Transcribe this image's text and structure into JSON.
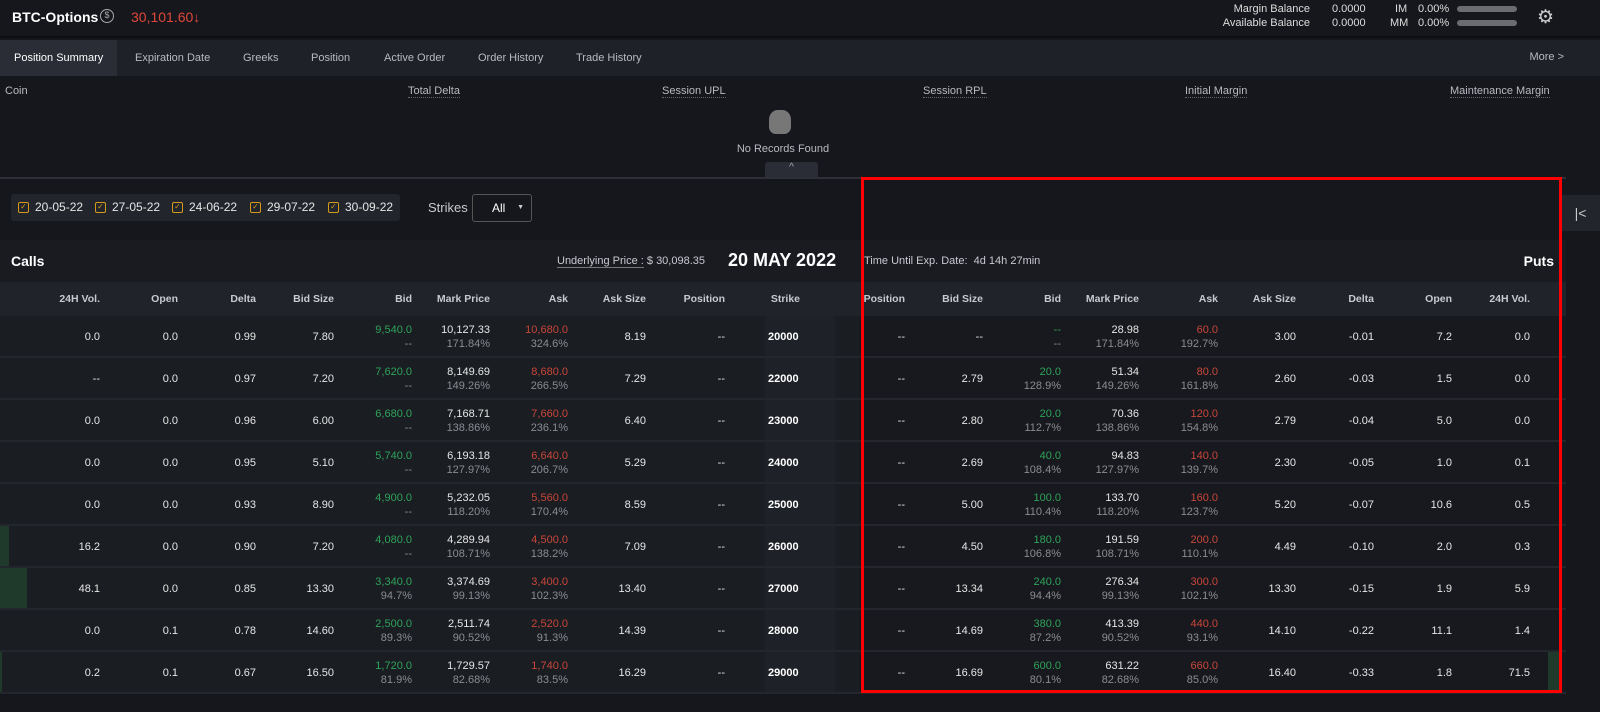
{
  "header": {
    "title": "BTC-Options",
    "coin_icon": "dollar-coin-icon",
    "price": "30,101.60",
    "price_arrow": "↓",
    "margin_balance_label": "Margin Balance",
    "margin_balance": "0.0000",
    "available_balance_label": "Available Balance",
    "available_balance": "0.0000",
    "im_label": "IM",
    "im_value": "0.00%",
    "mm_label": "MM",
    "mm_value": "0.00%",
    "im_fill": 0,
    "mm_fill": 0
  },
  "tabs": [
    "Position Summary",
    "Expiration Date",
    "Greeks",
    "Position",
    "Active Order",
    "Order History",
    "Trade History"
  ],
  "more_label": "More >",
  "summary": {
    "columns": [
      "Coin",
      "Total Delta",
      "Session UPL",
      "Session RPL",
      "Initial Margin",
      "Maintenance Margin"
    ],
    "empty_text": "No Records Found"
  },
  "filters": {
    "dates": [
      "20-05-22",
      "27-05-22",
      "24-06-22",
      "29-07-22",
      "30-09-22"
    ],
    "strikes_label": "Strikes",
    "strikes_value": "All"
  },
  "section": {
    "calls": "Calls",
    "puts": "Puts",
    "underlying_label": "Underlying Price :",
    "underlying_value": "$ 30,098.35",
    "expiry": "20 MAY 2022",
    "time_label": "Time Until Exp. Date:",
    "time_value": "4d 14h 27min"
  },
  "colors": {
    "bid": "#2ea35a",
    "ask": "#c9463a",
    "price_down": "#e0473a",
    "checkbox": "#d49a1a"
  },
  "calls_columns": [
    "24H Vol.",
    "Open",
    "Delta",
    "Bid Size",
    "Bid",
    "Mark Price",
    "Ask",
    "Ask Size",
    "Position",
    "Strike"
  ],
  "puts_columns": [
    "Position",
    "Bid Size",
    "Bid",
    "Mark Price",
    "Ask",
    "Ask Size",
    "Delta",
    "Open",
    "24H Vol."
  ],
  "rows": [
    {
      "strike": "20000",
      "call": {
        "vol": "0.0",
        "open": "0.0",
        "delta": "0.99",
        "bid_size": "7.80",
        "bid": "9,540.0",
        "bid_iv": "--",
        "mark": "10,127.33",
        "mark_iv": "171.84%",
        "ask": "10,680.0",
        "ask_iv": "324.6%",
        "ask_size": "8.19",
        "position": "--"
      },
      "put": {
        "position": "--",
        "bid_size": "--",
        "bid": "--",
        "bid_iv": "--",
        "mark": "28.98",
        "mark_iv": "171.84%",
        "ask": "60.0",
        "ask_iv": "192.7%",
        "ask_size": "3.00",
        "delta": "-0.01",
        "open": "7.2",
        "vol": "0.0"
      }
    },
    {
      "strike": "22000",
      "call": {
        "vol": "--",
        "open": "0.0",
        "delta": "0.97",
        "bid_size": "7.20",
        "bid": "7,620.0",
        "bid_iv": "--",
        "mark": "8,149.69",
        "mark_iv": "149.26%",
        "ask": "8,680.0",
        "ask_iv": "266.5%",
        "ask_size": "7.29",
        "position": "--"
      },
      "put": {
        "position": "--",
        "bid_size": "2.79",
        "bid": "20.0",
        "bid_iv": "128.9%",
        "mark": "51.34",
        "mark_iv": "149.26%",
        "ask": "80.0",
        "ask_iv": "161.8%",
        "ask_size": "2.60",
        "delta": "-0.03",
        "open": "1.5",
        "vol": "0.0"
      }
    },
    {
      "strike": "23000",
      "call": {
        "vol": "0.0",
        "open": "0.0",
        "delta": "0.96",
        "bid_size": "6.00",
        "bid": "6,680.0",
        "bid_iv": "--",
        "mark": "7,168.71",
        "mark_iv": "138.86%",
        "ask": "7,660.0",
        "ask_iv": "236.1%",
        "ask_size": "6.40",
        "position": "--"
      },
      "put": {
        "position": "--",
        "bid_size": "2.80",
        "bid": "20.0",
        "bid_iv": "112.7%",
        "mark": "70.36",
        "mark_iv": "138.86%",
        "ask": "120.0",
        "ask_iv": "154.8%",
        "ask_size": "2.79",
        "delta": "-0.04",
        "open": "5.0",
        "vol": "0.0"
      }
    },
    {
      "strike": "24000",
      "call": {
        "vol": "0.0",
        "open": "0.0",
        "delta": "0.95",
        "bid_size": "5.10",
        "bid": "5,740.0",
        "bid_iv": "--",
        "mark": "6,193.18",
        "mark_iv": "127.97%",
        "ask": "6,640.0",
        "ask_iv": "206.7%",
        "ask_size": "5.29",
        "position": "--"
      },
      "put": {
        "position": "--",
        "bid_size": "2.69",
        "bid": "40.0",
        "bid_iv": "108.4%",
        "mark": "94.83",
        "mark_iv": "127.97%",
        "ask": "140.0",
        "ask_iv": "139.7%",
        "ask_size": "2.30",
        "delta": "-0.05",
        "open": "1.0",
        "vol": "0.1"
      }
    },
    {
      "strike": "25000",
      "call": {
        "vol": "0.0",
        "open": "0.0",
        "delta": "0.93",
        "bid_size": "8.90",
        "bid": "4,900.0",
        "bid_iv": "--",
        "mark": "5,232.05",
        "mark_iv": "118.20%",
        "ask": "5,560.0",
        "ask_iv": "170.4%",
        "ask_size": "8.59",
        "position": "--"
      },
      "put": {
        "position": "--",
        "bid_size": "5.00",
        "bid": "100.0",
        "bid_iv": "110.4%",
        "mark": "133.70",
        "mark_iv": "118.20%",
        "ask": "160.0",
        "ask_iv": "123.7%",
        "ask_size": "5.20",
        "delta": "-0.07",
        "open": "10.6",
        "vol": "0.5"
      }
    },
    {
      "strike": "26000",
      "call": {
        "vol": "16.2",
        "open": "0.0",
        "delta": "0.90",
        "bid_size": "7.20",
        "bid": "4,080.0",
        "bid_iv": "--",
        "mark": "4,289.94",
        "mark_iv": "108.71%",
        "ask": "4,500.0",
        "ask_iv": "138.2%",
        "ask_size": "7.09",
        "position": "--"
      },
      "put": {
        "position": "--",
        "bid_size": "4.50",
        "bid": "180.0",
        "bid_iv": "106.8%",
        "mark": "191.59",
        "mark_iv": "108.71%",
        "ask": "200.0",
        "ask_iv": "110.1%",
        "ask_size": "4.49",
        "delta": "-0.10",
        "open": "2.0",
        "vol": "0.3"
      }
    },
    {
      "strike": "27000",
      "call": {
        "vol": "48.1",
        "open": "0.0",
        "delta": "0.85",
        "bid_size": "13.30",
        "bid": "3,340.0",
        "bid_iv": "94.7%",
        "mark": "3,374.69",
        "mark_iv": "99.13%",
        "ask": "3,400.0",
        "ask_iv": "102.3%",
        "ask_size": "13.40",
        "position": "--"
      },
      "put": {
        "position": "--",
        "bid_size": "13.34",
        "bid": "240.0",
        "bid_iv": "94.4%",
        "mark": "276.34",
        "mark_iv": "99.13%",
        "ask": "300.0",
        "ask_iv": "102.1%",
        "ask_size": "13.30",
        "delta": "-0.15",
        "open": "1.9",
        "vol": "5.9"
      }
    },
    {
      "strike": "28000",
      "call": {
        "vol": "0.0",
        "open": "0.1",
        "delta": "0.78",
        "bid_size": "14.60",
        "bid": "2,500.0",
        "bid_iv": "89.3%",
        "mark": "2,511.74",
        "mark_iv": "90.52%",
        "ask": "2,520.0",
        "ask_iv": "91.3%",
        "ask_size": "14.39",
        "position": "--"
      },
      "put": {
        "position": "--",
        "bid_size": "14.69",
        "bid": "380.0",
        "bid_iv": "87.2%",
        "mark": "413.39",
        "mark_iv": "90.52%",
        "ask": "440.0",
        "ask_iv": "93.1%",
        "ask_size": "14.10",
        "delta": "-0.22",
        "open": "11.1",
        "vol": "1.4"
      }
    },
    {
      "strike": "29000",
      "call": {
        "vol": "0.2",
        "open": "0.1",
        "delta": "0.67",
        "bid_size": "16.50",
        "bid": "1,720.0",
        "bid_iv": "81.9%",
        "mark": "1,729.57",
        "mark_iv": "82.68%",
        "ask": "1,740.0",
        "ask_iv": "83.5%",
        "ask_size": "16.29",
        "position": "--"
      },
      "put": {
        "position": "--",
        "bid_size": "16.69",
        "bid": "600.0",
        "bid_iv": "80.1%",
        "mark": "631.22",
        "mark_iv": "82.68%",
        "ask": "660.0",
        "ask_iv": "85.0%",
        "ask_size": "16.40",
        "delta": "-0.33",
        "open": "1.8",
        "vol": "71.5"
      }
    }
  ]
}
